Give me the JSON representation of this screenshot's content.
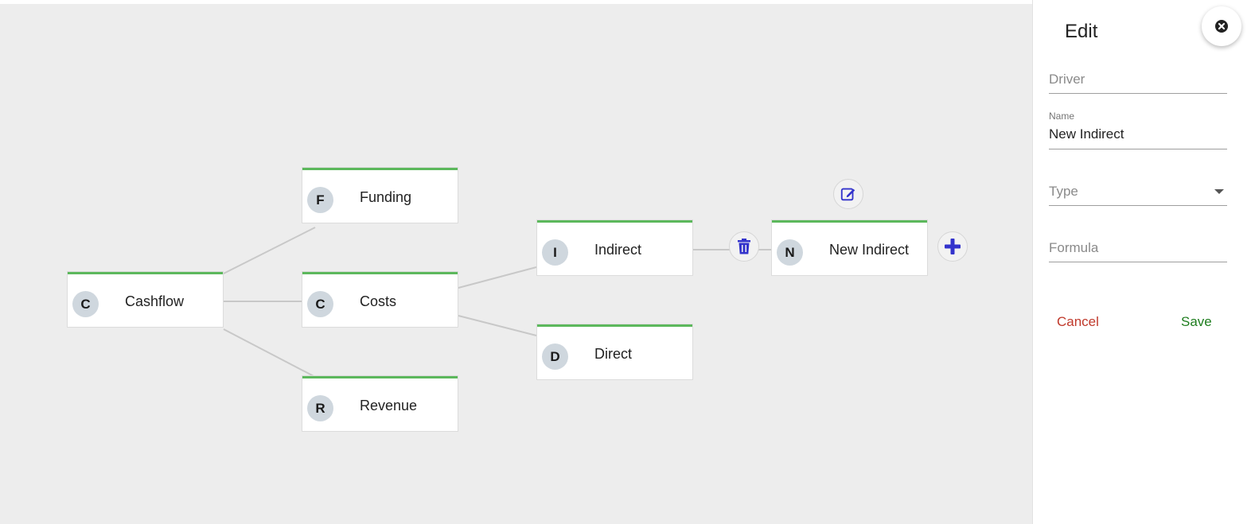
{
  "nodes": {
    "cashflow": {
      "badge": "C",
      "label": "Cashflow"
    },
    "funding": {
      "badge": "F",
      "label": "Funding"
    },
    "costs": {
      "badge": "C",
      "label": "Costs"
    },
    "revenue": {
      "badge": "R",
      "label": "Revenue"
    },
    "indirect": {
      "badge": "I",
      "label": "Indirect"
    },
    "direct": {
      "badge": "D",
      "label": "Direct"
    },
    "new_indirect": {
      "badge": "N",
      "label": "New Indirect"
    }
  },
  "node_actions": {
    "edit_icon": "edit-icon",
    "delete_icon": "trash-icon",
    "add_icon": "plus-icon"
  },
  "panel": {
    "title": "Edit",
    "close_icon": "close-icon",
    "driver_placeholder": "Driver",
    "name_label": "Name",
    "name_value": "New Indirect",
    "type_placeholder": "Type",
    "formula_placeholder": "Formula",
    "cancel_label": "Cancel",
    "save_label": "Save"
  },
  "colors": {
    "node_accent": "#5cb85c",
    "action_icon": "#3333cc",
    "cancel": "#c0392b",
    "save": "#1e7d1e"
  }
}
